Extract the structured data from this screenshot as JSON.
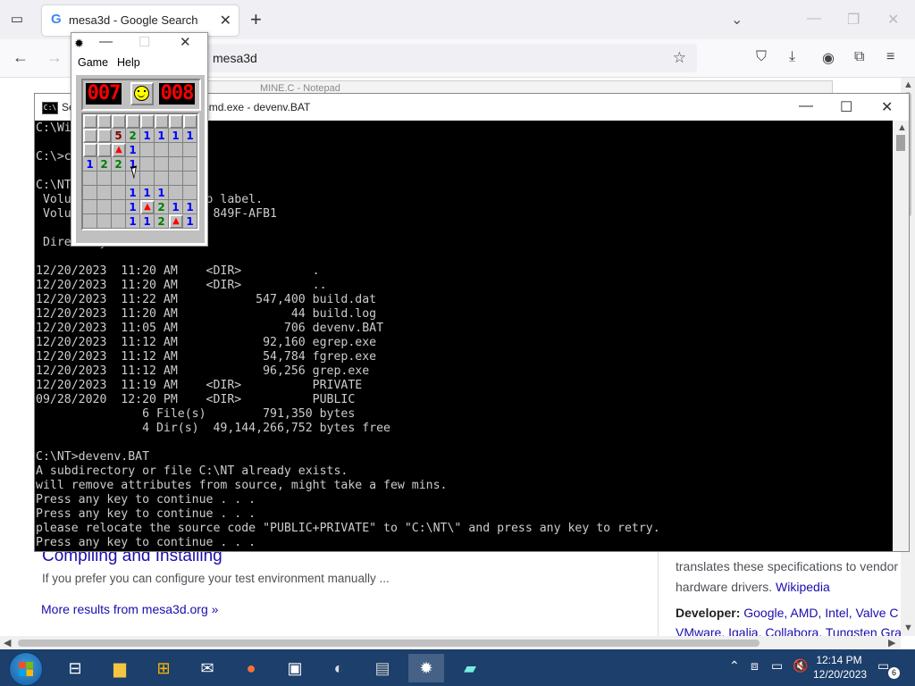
{
  "browser": {
    "tab_title": "mesa3d - Google Search",
    "url": "mesa3d",
    "behind_window_title": "MINE.C - Notepad",
    "results": {
      "title": "Compiling and Installing",
      "snippet": "If you prefer you can configure your test environment manually ...",
      "more": "More results from mesa3d.org »"
    },
    "side": {
      "desc1": "translates these specifications to vendor",
      "desc2_text": "hardware drivers. ",
      "desc2_link": "Wikipedia",
      "dev_label": "Developer:",
      "dev_line1": " Google, AMD, Intel, Valve C",
      "dev_line2": "VMware, Igalia, Collabora, Tungsten Gra"
    }
  },
  "cmd": {
    "title": "Select C:\\Windows\\system32\\cmd.exe - devenv.BAT",
    "output": "C:\\Windows\\system32>\n\nC:\\>cd NT\n\nC:\\NT>dir\n Volume in drive C has no label.\n Volume Serial Number is 849F-AFB1\n\n Directory of C:\\NT\n\n12/20/2023  11:20 AM    <DIR>          .\n12/20/2023  11:20 AM    <DIR>          ..\n12/20/2023  11:22 AM           547,400 build.dat\n12/20/2023  11:20 AM                44 build.log\n12/20/2023  11:05 AM               706 devenv.BAT\n12/20/2023  11:12 AM            92,160 egrep.exe\n12/20/2023  11:12 AM            54,784 fgrep.exe\n12/20/2023  11:12 AM            96,256 grep.exe\n12/20/2023  11:19 AM    <DIR>          PRIVATE\n09/28/2020  12:20 PM    <DIR>          PUBLIC\n               6 File(s)        791,350 bytes\n               4 Dir(s)  49,144,266,752 bytes free\n\nC:\\NT>devenv.BAT\nA subdirectory or file C:\\NT already exists.\nwill remove attributes from source, might take a few mins.\nPress any key to continue . . .\nPress any key to continue . . .\nplease relocate the source code \"PUBLIC+PRIVATE\" to \"C:\\NT\\\" and press any key to retry.\nPress any key to continue . . ."
  },
  "minesweeper": {
    "menu_game": "Game",
    "menu_help": "Help",
    "mine_counter": "007",
    "timer": "008",
    "grid": [
      [
        "c",
        "c",
        "c",
        "c",
        "c",
        "c",
        "c",
        "c"
      ],
      [
        "c",
        "c",
        "5",
        "2",
        "1",
        "1",
        "1",
        "1"
      ],
      [
        "c",
        "c",
        "F",
        "1",
        "o",
        "o",
        "o",
        "o"
      ],
      [
        "1",
        "2",
        "2",
        "1",
        "o",
        "o",
        "o",
        "o"
      ],
      [
        "o",
        "o",
        "o",
        "o",
        "o",
        "o",
        "o",
        "o"
      ],
      [
        "o",
        "o",
        "o",
        "1",
        "1",
        "1",
        "o",
        "o"
      ],
      [
        "o",
        "o",
        "o",
        "1",
        "F",
        "2",
        "1",
        "1"
      ],
      [
        "o",
        "o",
        "o",
        "1",
        "1",
        "2",
        "F",
        "1"
      ]
    ]
  },
  "taskbar": {
    "time": "12:14 PM",
    "date": "12/20/2023",
    "notification_count": "6"
  },
  "colors": {
    "taskbar": "#1d3f6b",
    "link": "#1a0dab",
    "cmd_bg": "#000000",
    "cmd_fg": "#cccccc"
  }
}
